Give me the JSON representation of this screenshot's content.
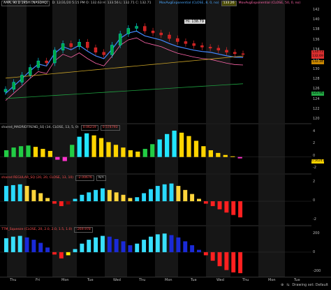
{
  "header": {
    "symbol": "AAPL 90 D 195m [NASDAQ]",
    "ohlc": "D: 12/31/20 5:15 PM  O: 132.63  H: 133.56  L: 132.71  C: 132.71",
    "ma1": "MovAvgExponential (CLOSE, 8, 0, no)",
    "ma1_val": "133.26",
    "ma2": "MovAvgExponential (CLOSE, 50, 0, no)",
    "hi_label": "Hi: 138.79"
  },
  "price_axis": {
    "ticks": [
      "142",
      "140",
      "138",
      "136",
      "134",
      "132",
      "130",
      "128",
      "126",
      "124",
      "122",
      "120"
    ],
    "badges": [
      {
        "text": "133.73",
        "color": "#e03030"
      },
      {
        "text": "132.69",
        "color": "#e03030"
      },
      {
        "text": "132.34",
        "color": "#cc8800"
      },
      {
        "text": "125.96",
        "color": "#22aa44"
      }
    ]
  },
  "study1": {
    "title": "shared_MADRIDTREND_SQ (34, CLOSE, 13, 5, 0)",
    "v1": "0.06219",
    "v2": "0.574793",
    "axis": [
      "4",
      "2",
      "0",
      "-2"
    ],
    "badge": "0.56241"
  },
  "study2": {
    "title": "shared REGULAR_SQ (20, 20, CLOSE, 13, 10)",
    "v1": "-2.00676",
    "v2": "N/A",
    "axis": [
      "2",
      "0",
      "-2"
    ]
  },
  "study3": {
    "title": "TTM_Squeeze (CLOSE, 20, 2.0, 2.0, 1.5, 1.0)",
    "v1": "-269.978",
    "axis": [
      "200",
      "0",
      "-200"
    ]
  },
  "time_axis": [
    "Thu",
    "Fri",
    "Mon",
    "Tue",
    "Wed",
    "Thu",
    "Mon",
    "Tue",
    "Wed",
    "Thu",
    "Mon",
    "Tue"
  ],
  "status": {
    "drawing": "Drawing set: Default"
  },
  "colors": {
    "bull": "#00e5ff",
    "bear": "#ff3030",
    "ma_fast": "#4488ff",
    "ma_slow": "#ff66aa"
  },
  "chart_data": [
    {
      "type": "line",
      "title": "AAPL 90 D 195m [NASDAQ]",
      "xlabel": "",
      "ylabel": "",
      "ylim": [
        120,
        142
      ],
      "series": [
        {
          "name": "",
          "values": [
            125.8,
            127.2,
            128.6,
            130.1,
            131.4,
            131.0,
            133.5,
            134.8,
            134.2,
            135.1,
            134.0,
            133.1,
            132.6,
            134.5,
            136.7,
            137.8,
            138.2,
            137.3,
            136.9,
            136.5,
            135.8,
            135.2,
            134.8,
            134.4,
            134.1,
            133.9,
            133.5,
            133.1,
            132.8,
            132.7
          ]
        }
      ]
    },
    {
      "type": "bar",
      "title": "shared_MADRIDTREND_SQ (34, CLOSE, 13, 5, 0)",
      "ylim": [
        -2,
        4
      ],
      "values": [
        1.0,
        1.4,
        1.6,
        1.7,
        1.5,
        1.2,
        0.9,
        -0.4,
        -0.6,
        1.8,
        3.0,
        3.5,
        3.2,
        2.8,
        2.2,
        1.8,
        1.4,
        1.0,
        0.8,
        1.2,
        1.9,
        2.6,
        3.4,
        3.9,
        3.6,
        3.1,
        2.4,
        1.6,
        1.0,
        0.6,
        0.3,
        0.1,
        -0.2
      ]
    },
    {
      "type": "bar",
      "title": "shared REGULAR_SQ (20, 20, CLOSE, 13, 10)",
      "ylim": [
        -2.6,
        2.6
      ],
      "values": [
        1.9,
        2.0,
        2.1,
        1.9,
        1.4,
        1.0,
        0.4,
        -0.3,
        -0.6,
        -0.4,
        0.3,
        0.8,
        1.1,
        1.4,
        1.6,
        1.4,
        1.1,
        0.8,
        0.4,
        0.5,
        1.0,
        1.5,
        1.9,
        2.1,
        2.2,
        1.9,
        1.4,
        0.9,
        0.3,
        -0.3,
        -0.6,
        -1.0,
        -1.4,
        -1.7,
        -2.0
      ]
    },
    {
      "type": "bar",
      "title": "TTM_Squeeze (CLOSE, 20, 2.0, 2.0, 1.5, 1.0)",
      "ylim": [
        -280,
        260
      ],
      "values": [
        180,
        200,
        210,
        190,
        160,
        120,
        60,
        -30,
        -80,
        -40,
        40,
        110,
        160,
        190,
        210,
        200,
        170,
        140,
        90,
        110,
        160,
        200,
        230,
        240,
        220,
        190,
        140,
        90,
        30,
        -40,
        -110,
        -180,
        -230,
        -260,
        -270
      ]
    }
  ]
}
